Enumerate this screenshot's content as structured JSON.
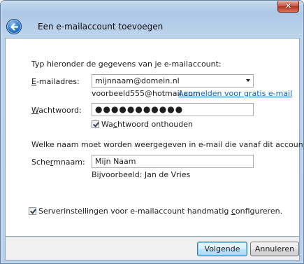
{
  "window": {
    "close_glyph": "✕",
    "back_icon": "back-arrow-icon",
    "title": "Een e-mailaccount toevoegen"
  },
  "form": {
    "intro": "Typ hieronder de gegevens van je e-mailaccount:",
    "email": {
      "label_prefix": "E",
      "label_rest": "-mailadres:",
      "value": "mijnnaam@domein.nl",
      "example": "voorbeeld555@hotmail.com",
      "signup_link": "Aanmelden voor gratis e-mail"
    },
    "password": {
      "label_prefix": "W",
      "label_rest": "achtwoord:",
      "value": "●●●●●●●●●●●",
      "remember_prefix": "Wa",
      "remember_mid": "c",
      "remember_rest": "htwoord onthouden",
      "remember_checked": true
    },
    "display_question": "Welke naam moet worden weergegeven in e-mail die vanaf dit account verzonden wordt?",
    "display_name": {
      "label_prefix": "Sche",
      "label_mid": "r",
      "label_rest": "mnaam:",
      "value": "Mijn Naam",
      "example_prefix": "Bi",
      "example_mid": "j",
      "example_rest": "voorbeeld: Jan de Vries"
    },
    "manual_config": {
      "label_prefix": "Serverinstellingen voor e-mailaccount handmatig ",
      "label_mid": "c",
      "label_rest": "onfigureren.",
      "checked": true
    }
  },
  "buttons": {
    "next": "Volgende",
    "cancel": "Annuleren"
  },
  "colors": {
    "link": "#0b64c4",
    "default_button_border": "#3c7fb1"
  }
}
